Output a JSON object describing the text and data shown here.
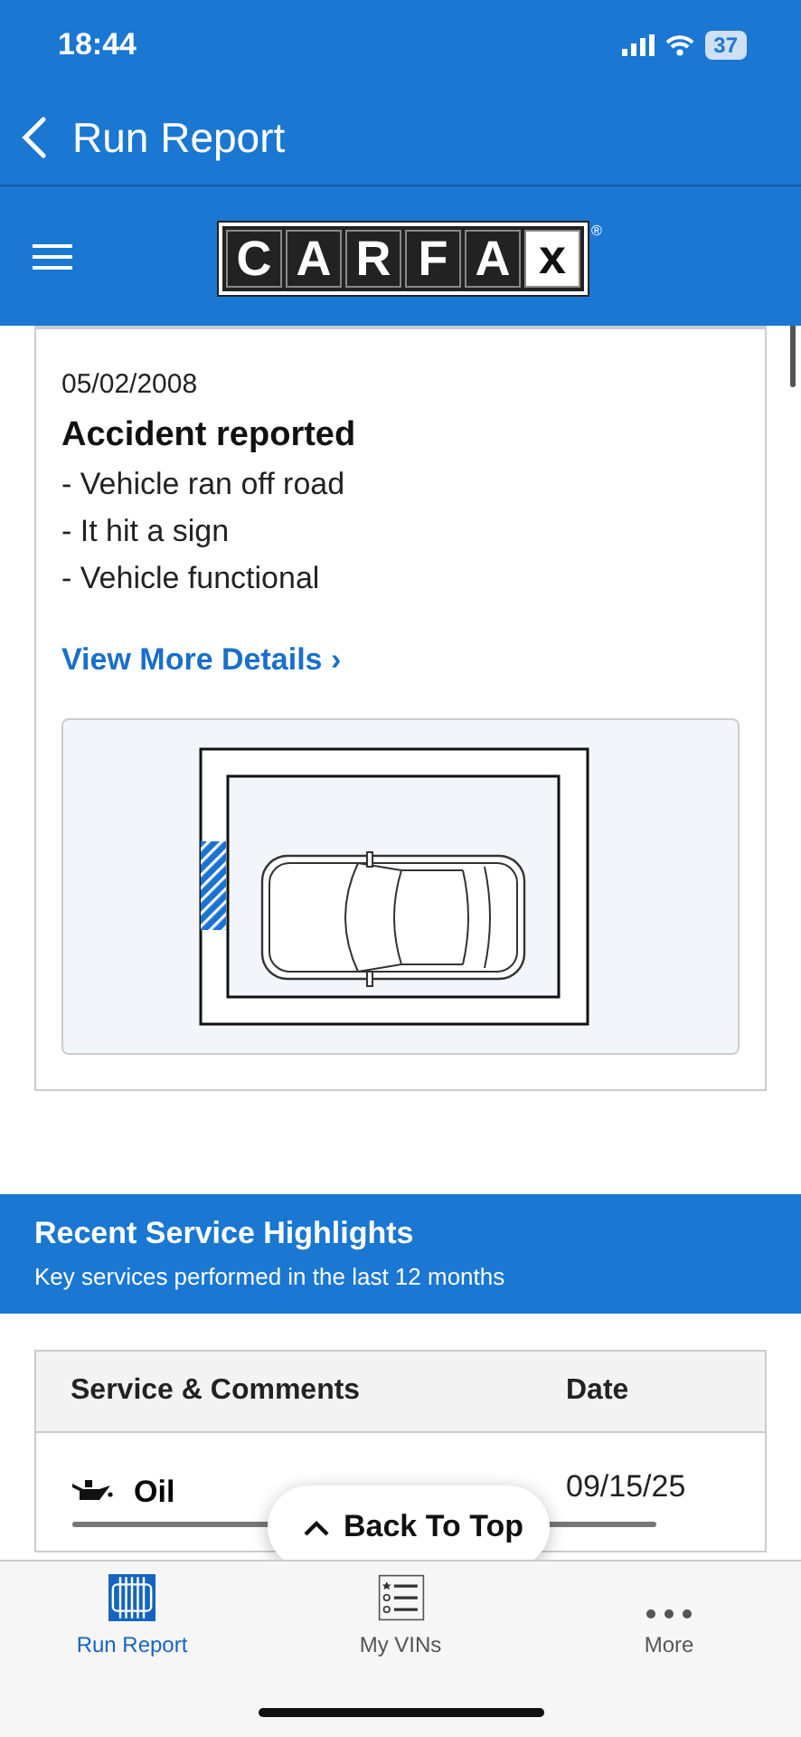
{
  "status_bar": {
    "time": "18:44",
    "battery": "37"
  },
  "nav": {
    "back_label": "Run Report"
  },
  "logo": {
    "letters": [
      "C",
      "A",
      "R",
      "F",
      "A",
      "x"
    ],
    "mark": "®"
  },
  "record": {
    "date": "05/02/2008",
    "title": "Accident reported",
    "details": [
      "- Vehicle ran off road",
      "- It hit a sign",
      "- Vehicle functional"
    ],
    "link": "View More Details",
    "link_icon": "›"
  },
  "service": {
    "title": "Recent Service Highlights",
    "subtitle": "Key services performed in the last 12 months",
    "columns": [
      "Service & Comments",
      "Date"
    ],
    "rows": [
      {
        "service": "Oil",
        "date": "09/15/25"
      }
    ]
  },
  "back_to_top": "Back To Top",
  "tabs": [
    {
      "label": "Run Report",
      "kind": "report",
      "selected": true
    },
    {
      "label": "My VINs",
      "kind": "list",
      "selected": false
    },
    {
      "label": "More",
      "kind": "more",
      "selected": false
    }
  ]
}
